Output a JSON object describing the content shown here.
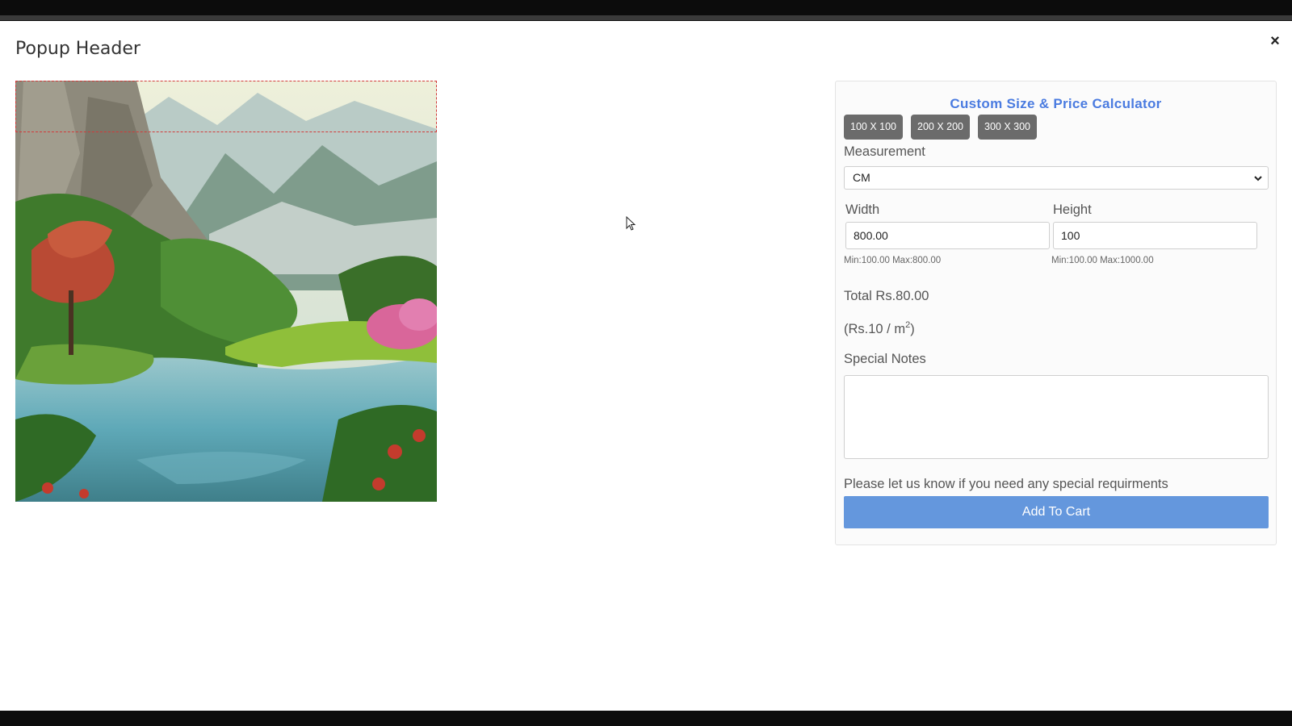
{
  "modal": {
    "title": "Popup Header",
    "close_label": "×",
    "close_icon": "close-icon"
  },
  "product_image": {
    "description_icon": "landscape-image",
    "colors": {
      "sky": "#e8ecd6",
      "water": "#5fa9b8",
      "foliage": "#3f7a2c",
      "flowers": "#c43b2d",
      "rocks": "#8e8a7c"
    }
  },
  "calculator": {
    "title": "Custom Size & Price Calculator",
    "accent_color": "#4a7be0",
    "presets": [
      "100 X 100",
      "200 X 200",
      "300 X 300"
    ],
    "measurement_label": "Measurement",
    "measurement_value": "CM",
    "width_label": "Width",
    "width_value": "800.00",
    "width_hint": "Min:100.00 Max:800.00",
    "height_label": "Height",
    "height_value": "100",
    "height_hint": "Min:100.00 Max:1000.00",
    "total_text": "Total Rs.80.00",
    "rate_prefix": "(Rs.10 / m",
    "rate_sup": "2",
    "rate_suffix": ")",
    "notes_label": "Special Notes",
    "notes_value": "",
    "notes_help": "Please let us know if you need any special requirments",
    "add_to_cart_label": "Add To Cart",
    "button_color": "#6497dd"
  }
}
